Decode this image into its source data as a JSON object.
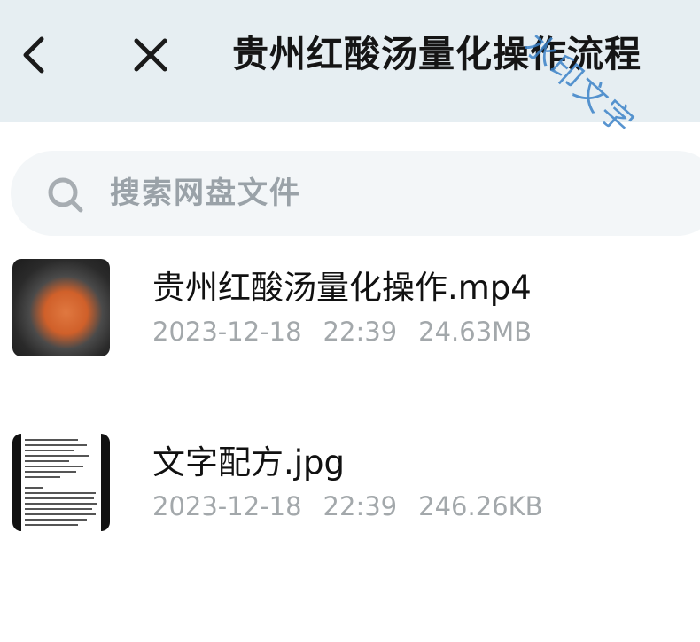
{
  "header": {
    "title": "贵州红酸汤量化操作流程",
    "back_icon": "chevron-left-icon",
    "close_icon": "close-icon"
  },
  "watermark": {
    "text": "水印文字",
    "color": "#3b82c8"
  },
  "search": {
    "placeholder": "搜索网盘文件",
    "value": "",
    "icon": "search-icon"
  },
  "files": [
    {
      "name": "贵州红酸汤量化操作.mp4",
      "date": "2023-12-18",
      "time": "22:39",
      "size": "24.63MB",
      "thumbnail": "video-thumbnail"
    },
    {
      "name": "文字配方.jpg",
      "date": "2023-12-18",
      "time": "22:39",
      "size": "246.26KB",
      "thumbnail": "document-thumbnail"
    }
  ],
  "colors": {
    "header_bg": "#e6eef2",
    "search_bg": "#f3f6f8",
    "meta_text": "#a3a8ab",
    "title_text": "#151515"
  }
}
